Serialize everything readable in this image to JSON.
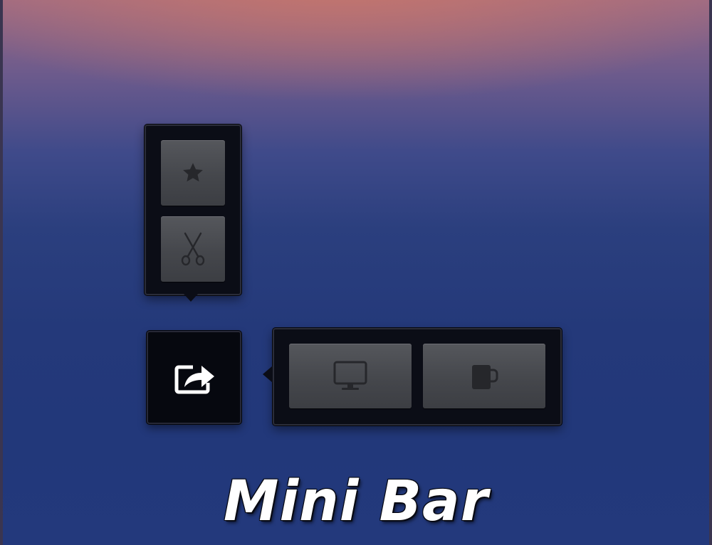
{
  "title": "Mini Bar",
  "colors": {
    "popover_background": "#0b0d16",
    "tile_face": "#4a4c51",
    "icon_fill": "#26272b",
    "share_icon": "#ffffff"
  },
  "vertical_menu": {
    "items": [
      {
        "icon": "star-icon"
      },
      {
        "icon": "scissors-icon"
      }
    ]
  },
  "share_button": {
    "icon": "share-arrow-icon"
  },
  "horizontal_menu": {
    "items": [
      {
        "icon": "monitor-icon"
      },
      {
        "icon": "mug-icon"
      }
    ]
  }
}
